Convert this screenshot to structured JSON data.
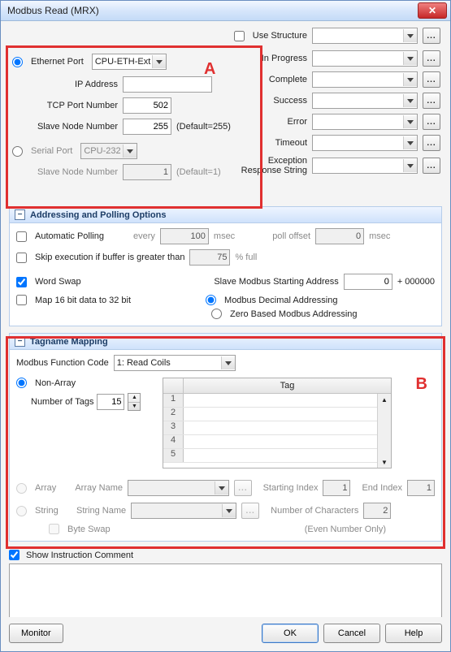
{
  "window": {
    "title": "Modbus Read (MRX)"
  },
  "overlays": {
    "A": "A",
    "B": "B"
  },
  "structure": {
    "use_structure_label": "Use Structure",
    "use_structure_checked": false,
    "combo_value": ""
  },
  "conn": {
    "eth_radio_label": "Ethernet Port",
    "eth_combo": "CPU-ETH-Ext",
    "ip_label": "IP Address",
    "ip_value": "",
    "tcp_label": "TCP Port Number",
    "tcp_value": "502",
    "eth_slave_label": "Slave Node Number",
    "eth_slave_value": "255",
    "eth_slave_hint": "(Default=255)",
    "serial_radio_label": "Serial Port",
    "serial_combo": "CPU-232",
    "serial_slave_label": "Slave Node Number",
    "serial_slave_value": "1",
    "serial_slave_hint": "(Default=1)"
  },
  "status": {
    "in_progress": "In Progress",
    "complete": "Complete",
    "success": "Success",
    "error": "Error",
    "timeout": "Timeout",
    "exception": "Exception Response String"
  },
  "polling": {
    "header": "Addressing and Polling Options",
    "auto_label": "Automatic Polling",
    "every_label": "every",
    "every_value": "100",
    "msec": "msec",
    "poll_offset_label": "poll offset",
    "poll_offset_value": "0",
    "skip_label": "Skip execution if buffer is greater than",
    "skip_value": "75",
    "pct_full": "% full",
    "word_swap": "Word Swap",
    "map16_label": "Map 16 bit data to 32 bit",
    "start_addr_label": "Slave Modbus Starting Address",
    "start_addr_value": "0",
    "start_addr_suffix": "+ 000000",
    "dec_addr": "Modbus Decimal Addressing",
    "zero_addr": "Zero Based Modbus Addressing"
  },
  "tagmap": {
    "header": "Tagname Mapping",
    "func_label": "Modbus Function Code",
    "func_value": "1: Read Coils",
    "nonarray": "Non-Array",
    "num_tags_label": "Number of Tags",
    "num_tags_value": "15",
    "tag_col": "Tag",
    "rows": [
      "1",
      "2",
      "3",
      "4",
      "5"
    ],
    "array": "Array",
    "array_name_label": "Array Name",
    "start_index_label": "Starting Index",
    "start_index_value": "1",
    "end_index_label": "End Index",
    "end_index_value": "1",
    "string": "String",
    "string_name_label": "String Name",
    "num_chars_label": "Number of Characters",
    "num_chars_value": "2",
    "byte_swap": "Byte Swap",
    "even_note": "(Even Number Only)"
  },
  "comment": {
    "show_label": "Show Instruction Comment",
    "text": ""
  },
  "buttons": {
    "monitor": "Monitor",
    "ok": "OK",
    "cancel": "Cancel",
    "help": "Help"
  }
}
